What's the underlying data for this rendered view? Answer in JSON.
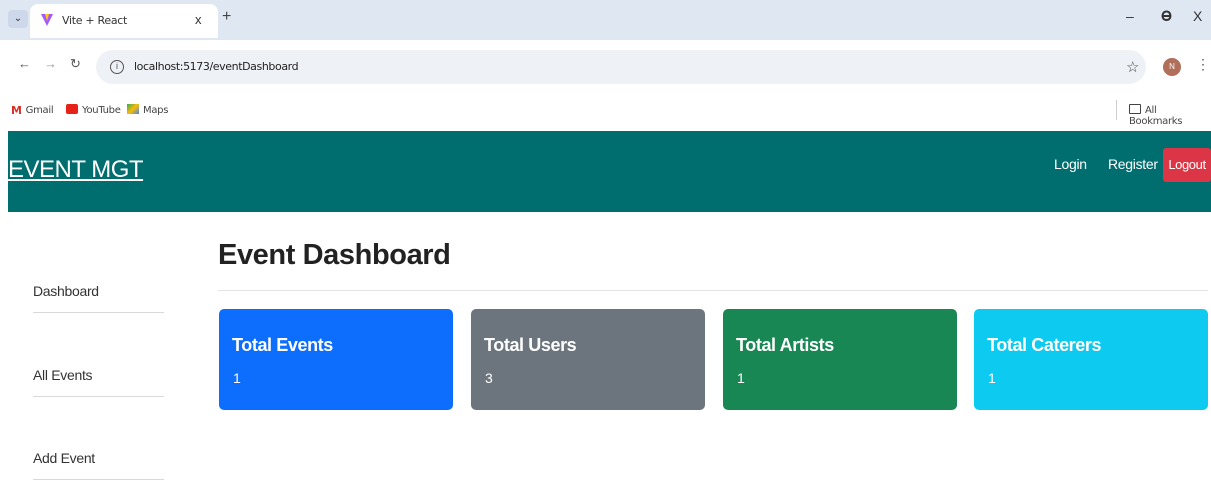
{
  "browser": {
    "tab_title": "Vite + React",
    "tab_close": "x",
    "new_tab": "+",
    "url": "localhost:5173/eventDashboard",
    "profile_initial": "N",
    "window_minimize": "–",
    "window_restore": "ə",
    "window_close": "X",
    "bookmarks": [
      {
        "label": "Gmail"
      },
      {
        "label": "YouTube"
      },
      {
        "label": "Maps"
      }
    ],
    "all_bookmarks": "All Bookmarks"
  },
  "navbar": {
    "brand": "EVENT MGT",
    "login": "Login",
    "register": "Register",
    "logout": "Logout",
    "background": "#006d6f"
  },
  "sidebar": {
    "items": [
      {
        "label": "Dashboard"
      },
      {
        "label": "All Events"
      },
      {
        "label": "Add Event"
      }
    ]
  },
  "main": {
    "title": "Event Dashboard",
    "cards": [
      {
        "title": "Total Events",
        "value": "1",
        "color": "#0d6efd"
      },
      {
        "title": "Total Users",
        "value": "3",
        "color": "#6c757d"
      },
      {
        "title": "Total Artists",
        "value": "1",
        "color": "#198754"
      },
      {
        "title": "Total Caterers",
        "value": "1",
        "color": "#0dcaf0"
      }
    ]
  }
}
